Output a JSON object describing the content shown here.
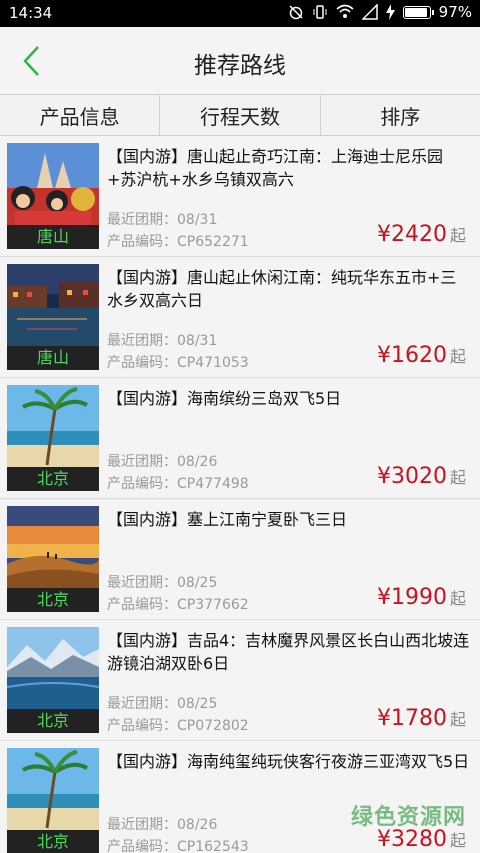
{
  "status": {
    "time": "14:34",
    "battery": "97%",
    "battery_level": 0.97
  },
  "header": {
    "title": "推荐路线"
  },
  "tabs": [
    {
      "label": "产品信息"
    },
    {
      "label": "行程天数"
    },
    {
      "label": "排序"
    }
  ],
  "labels": {
    "date_prefix": "最近团期：",
    "code_prefix": "产品编码：",
    "currency": "¥",
    "price_suffix": "起"
  },
  "items": [
    {
      "city": "唐山",
      "name": "【国内游】唐山起止奇巧江南：上海迪士尼乐园+苏沪杭+水乡乌镇双高六",
      "date": "08/31",
      "code": "CP652271",
      "price": "2420"
    },
    {
      "city": "唐山",
      "name": "【国内游】唐山起止休闲江南：纯玩华东五市+三水乡双高六日",
      "date": "08/31",
      "code": "CP471053",
      "price": "1620"
    },
    {
      "city": "北京",
      "name": "【国内游】海南缤纷三岛双飞5日",
      "date": "08/26",
      "code": "CP477498",
      "price": "3020"
    },
    {
      "city": "北京",
      "name": "【国内游】塞上江南宁夏卧飞三日",
      "date": "08/25",
      "code": "CP377662",
      "price": "1990"
    },
    {
      "city": "北京",
      "name": "【国内游】吉品4：吉林魔界风景区长白山西北坡连游镜泊湖双卧6日",
      "date": "08/25",
      "code": "CP072802",
      "price": "1780"
    },
    {
      "city": "北京",
      "name": "【国内游】海南纯玺纯玩侠客行夜游三亚湾双飞5日",
      "date": "08/26",
      "code": "CP162543",
      "price": "3280"
    }
  ],
  "watermark": "绿色资源网"
}
